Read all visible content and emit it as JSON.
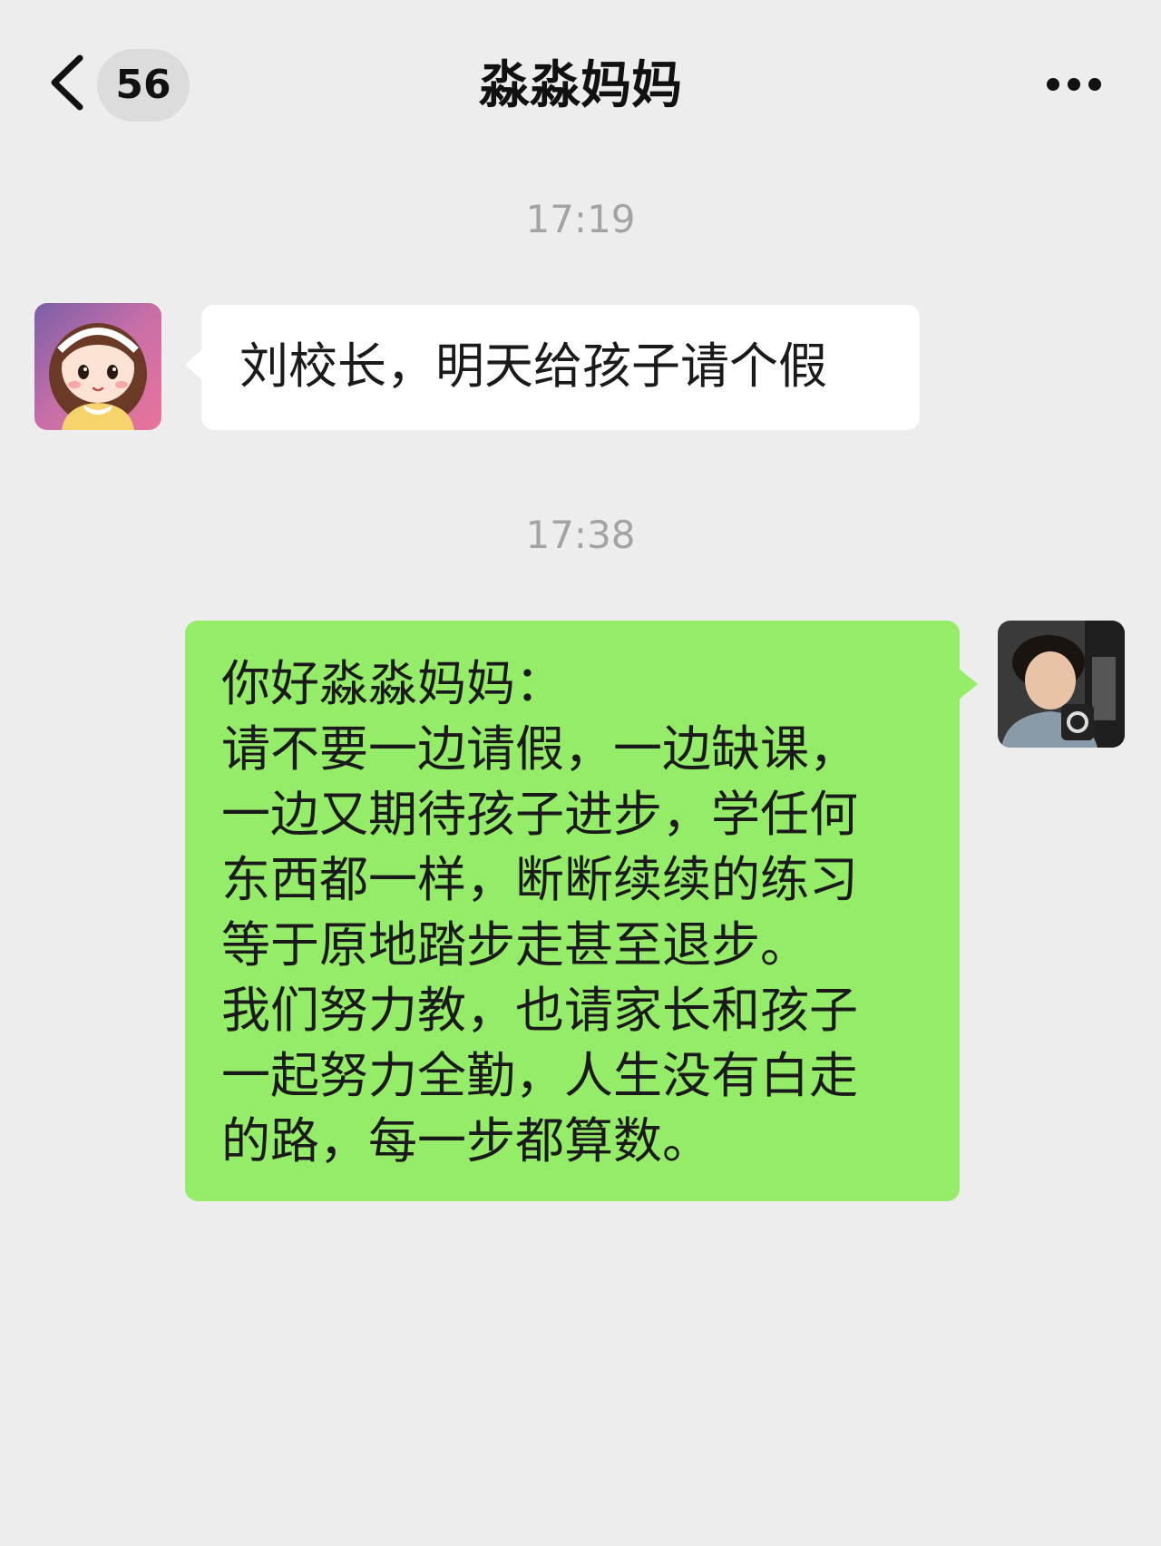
{
  "header": {
    "back_icon": "chevron-left-icon",
    "unread_count": "56",
    "title": "淼淼妈妈",
    "more_icon": "more-horizontal-icon"
  },
  "messages": [
    {
      "timestamp": "17:19",
      "direction": "incoming",
      "avatar": "cartoon-girl-avatar",
      "text": "刘校长，明天给孩子请个假"
    },
    {
      "timestamp": "17:38",
      "direction": "outgoing",
      "avatar": "user-photo-avatar",
      "text": "你好淼淼妈妈：\n请不要一边请假，一边缺课，\n一边又期待孩子进步，学任何\n东西都一样，断断续续的练习\n等于原地踏步走甚至退步。\n我们努力教，也请家长和孩子\n一起努力全勤，人生没有白走\n的路，每一步都算数。"
    }
  ],
  "colors": {
    "background": "#ededed",
    "incoming_bubble": "#ffffff",
    "outgoing_bubble": "#95ec69",
    "timestamp_text": "#a3a3a3",
    "badge_bg": "#dcdcdc"
  }
}
